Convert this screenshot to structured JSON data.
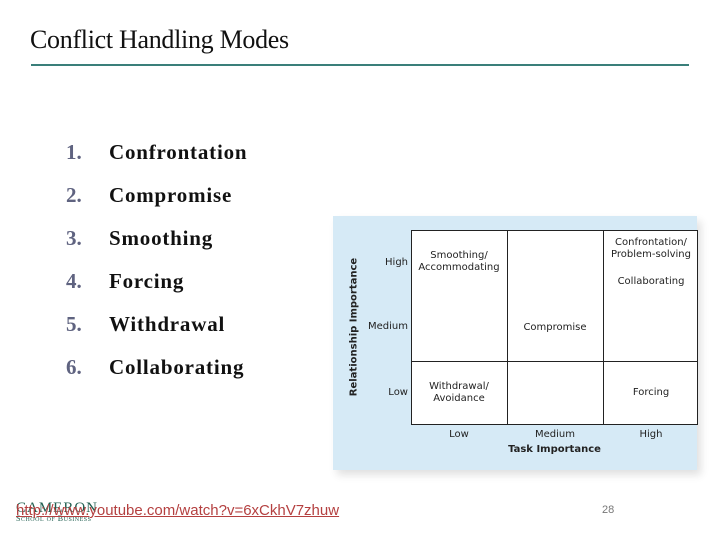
{
  "slide": {
    "title": "Conflict Handling Modes",
    "page_number": "28",
    "accent_color": "#3a7f7a"
  },
  "list": {
    "items": [
      {
        "number": "1.",
        "label": "Confrontation"
      },
      {
        "number": "2.",
        "label": "Compromise"
      },
      {
        "number": "3.",
        "label": "Smoothing"
      },
      {
        "number": "4.",
        "label": "Forcing"
      },
      {
        "number": "5.",
        "label": "Withdrawal"
      },
      {
        "number": "6.",
        "label": "Collaborating"
      }
    ]
  },
  "diagram": {
    "background_color": "#d6eaf6",
    "x_axis_label": "Task Importance",
    "y_axis_label": "Relationship Importance",
    "x_ticks": [
      "Low",
      "Medium",
      "High"
    ],
    "y_ticks": [
      "High",
      "Medium",
      "Low"
    ],
    "cells": {
      "smoothing_line1": "Smoothing/",
      "smoothing_line2": "Accommodating",
      "confrontation_line1": "Confrontation/",
      "confrontation_line2": "Problem-solving",
      "collaborating": "Collaborating",
      "compromise": "Compromise",
      "withdrawal_line1": "Withdrawal/",
      "withdrawal_line2": "Avoidance",
      "forcing": "Forcing"
    }
  },
  "footer": {
    "logo_name": "CAMERON",
    "logo_subtitle": "School of Business",
    "link_text": "http://www.youtube.com/watch?v=6xCkhV7zhuw"
  }
}
